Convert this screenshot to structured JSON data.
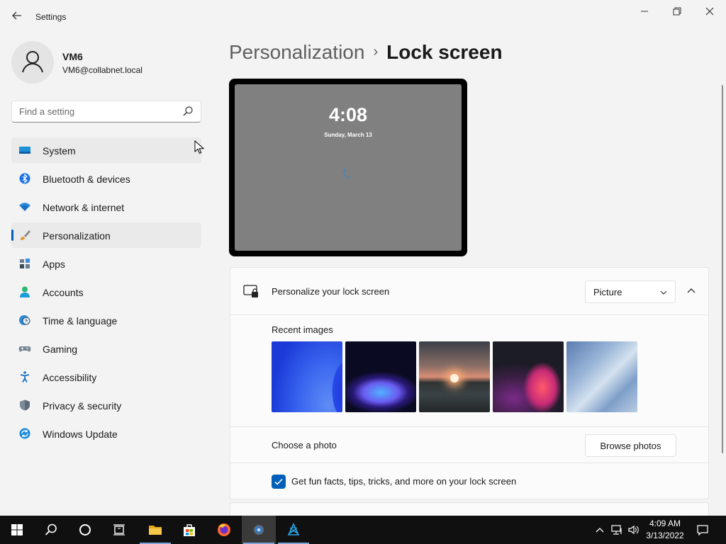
{
  "window": {
    "app_title": "Settings",
    "back_icon": "back-arrow-icon",
    "minimize_icon": "minimize-icon",
    "restore_icon": "restore-icon",
    "close_icon": "close-icon"
  },
  "profile": {
    "name": "VM6",
    "email": "VM6@collabnet.local"
  },
  "search": {
    "placeholder": "Find a setting",
    "value": ""
  },
  "sidebar": {
    "items": [
      {
        "label": "System",
        "icon": "system-icon",
        "state": "hover"
      },
      {
        "label": "Bluetooth & devices",
        "icon": "bluetooth-icon",
        "state": ""
      },
      {
        "label": "Network & internet",
        "icon": "network-icon",
        "state": ""
      },
      {
        "label": "Personalization",
        "icon": "personalization-brush-icon",
        "state": "active"
      },
      {
        "label": "Apps",
        "icon": "apps-icon",
        "state": ""
      },
      {
        "label": "Accounts",
        "icon": "accounts-icon",
        "state": ""
      },
      {
        "label": "Time & language",
        "icon": "time-language-icon",
        "state": ""
      },
      {
        "label": "Gaming",
        "icon": "gaming-icon",
        "state": ""
      },
      {
        "label": "Accessibility",
        "icon": "accessibility-icon",
        "state": ""
      },
      {
        "label": "Privacy & security",
        "icon": "privacy-shield-icon",
        "state": ""
      },
      {
        "label": "Windows Update",
        "icon": "windows-update-icon",
        "state": ""
      }
    ]
  },
  "breadcrumb": {
    "parent": "Personalization",
    "separator": "›",
    "current": "Lock screen"
  },
  "preview": {
    "time": "4:08",
    "date": "Sunday, March 13"
  },
  "lock_card": {
    "title": "Personalize your lock screen",
    "dropdown_value": "Picture",
    "recent_images_label": "Recent images",
    "recent_images": [
      "blue-bloom-wallpaper",
      "glow-sphere-wallpaper",
      "sunset-lake-wallpaper",
      "ribbon-swirl-wallpaper",
      "light-bloom-wallpaper"
    ],
    "choose_photo_label": "Choose a photo",
    "browse_button": "Browse photos",
    "fun_facts_label": "Get fun facts, tips, tricks, and more on your lock screen",
    "fun_facts_checked": true
  },
  "taskbar": {
    "time": "4:09 AM",
    "date": "3/13/2022"
  },
  "colors": {
    "accent": "#005fb8",
    "background": "#f3f3f3",
    "card": "#fbfbfb",
    "taskbar": "#101010"
  }
}
